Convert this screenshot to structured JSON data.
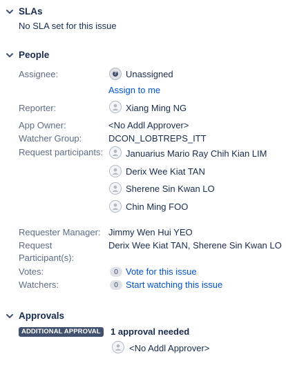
{
  "sla": {
    "title": "SLAs",
    "message": "No SLA set for this issue"
  },
  "people": {
    "title": "People",
    "assignee": {
      "label": "Assignee:",
      "value": "Unassigned",
      "action": "Assign to me"
    },
    "reporter": {
      "label": "Reporter:",
      "value": "Xiang Ming NG"
    },
    "app_owner": {
      "label": "App Owner:",
      "value": "<No Addl Approver>"
    },
    "watcher_group": {
      "label": "Watcher Group:",
      "value": "DCON_LOBTREPS_ITT"
    },
    "request_participants": {
      "label": "Request participants:",
      "items": [
        "Januarius Mario Ray Chih Kian LIM",
        "Derix Wee Kiat TAN",
        "Sherene Sin Kwan LO",
        "Chin Ming FOO"
      ]
    },
    "requester_manager": {
      "label": "Requester Manager:",
      "value": "Jimmy Wen Hui YEO"
    },
    "request_participant_s": {
      "label_line1": "Request",
      "label_line2": "Participant(s):",
      "value": "Derix Wee Kiat TAN, Sherene Sin Kwan LO"
    },
    "votes": {
      "label": "Votes:",
      "count": "0",
      "action": "Vote for this issue"
    },
    "watchers": {
      "label": "Watchers:",
      "count": "0",
      "action": "Start watching this issue"
    }
  },
  "approvals": {
    "title": "Approvals",
    "lozenge": "ADDITIONAL APPROVAL",
    "status": "1 approval needed",
    "approver": "<No Addl Approver>"
  },
  "colors": {
    "text": "#172b4d",
    "label": "#5e6c84",
    "link": "#0052cc",
    "lozenge_bg": "#42526e",
    "badge_bg": "#dfe1e6"
  }
}
